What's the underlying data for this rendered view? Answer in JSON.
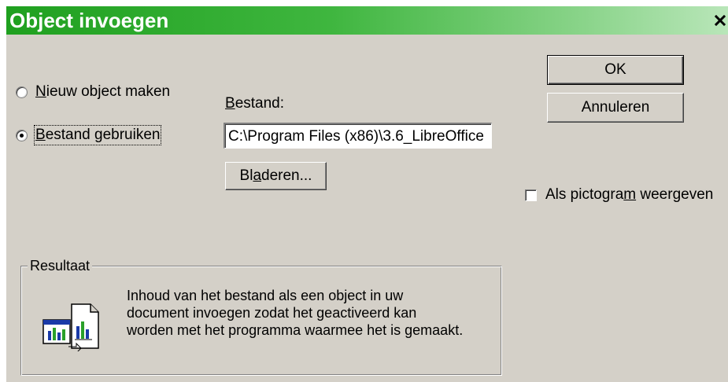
{
  "window": {
    "title": "Object invoegen",
    "close_glyph": "×"
  },
  "options": {
    "new_object": {
      "mnemonic": "N",
      "rest": "ieuw object maken",
      "selected": false
    },
    "from_file": {
      "mnemonic": "B",
      "rest": "estand gebruiken",
      "selected": true
    }
  },
  "file": {
    "label_mnemonic": "B",
    "label_rest": "estand:",
    "value": "C:\\Program Files (x86)\\3.6_LibreOffice",
    "browse_pre": "Bl",
    "browse_mnemonic": "a",
    "browse_post": "deren..."
  },
  "buttons": {
    "ok": "OK",
    "cancel": "Annuleren"
  },
  "display_as_icon": {
    "pre": "Als pictogra",
    "mnemonic": "m",
    "post": " weergeven",
    "checked": false
  },
  "result": {
    "legend": "Resultaat",
    "lines": [
      "Inhoud van het bestand als een object in uw",
      "document invoegen zodat het geactiveerd kan",
      "worden met het programma waarmee het is gemaakt."
    ],
    "icon": "document-link-icon"
  },
  "colors": {
    "title_gradient_start": "#1fa01f",
    "title_gradient_end": "#b9e6b9",
    "dialog_face": "#d4d0c8"
  }
}
